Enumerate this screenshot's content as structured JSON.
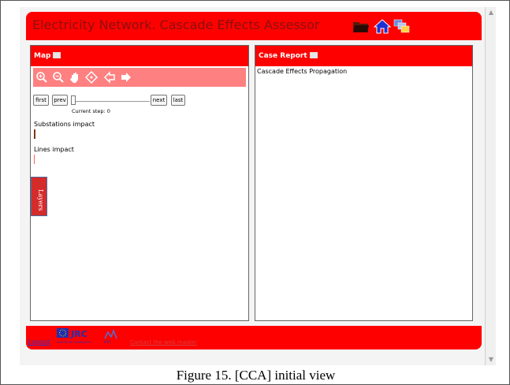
{
  "app": {
    "title": "Electricity Network. Cascade Effects Assessor"
  },
  "colors": {
    "header_red": "#ff0000",
    "toolbar_pink": "#ff8080",
    "layers_tab": "#d42b2b"
  },
  "header_icons": [
    "folder-icon",
    "home-icon",
    "windows-icon"
  ],
  "map_panel": {
    "title": "Map",
    "toolbar": [
      "zoom-in-icon",
      "zoom-out-icon",
      "pan-hand-icon",
      "full-extent-icon",
      "back-arrow-icon",
      "forward-arrow-icon"
    ],
    "buttons": {
      "first": "first",
      "prev": "prev",
      "next": "next",
      "last": "last"
    },
    "current_step_label": "Current step: 0",
    "slider_value": 0,
    "substations_label": "Substations impact",
    "lines_label": "Lines impact",
    "layers_tab": "Layers"
  },
  "report_panel": {
    "title": "Case Report",
    "content": "Cascade Effects Propagation"
  },
  "footer": {
    "logout": "Logout",
    "jrc_logo": "JRC",
    "eu_subtext": "EUROPEAN COMMISSION",
    "ipsc_logo": "IPSC",
    "contact_text": "Contact the web master"
  },
  "caption": "Figure 15. [CCA] initial view"
}
